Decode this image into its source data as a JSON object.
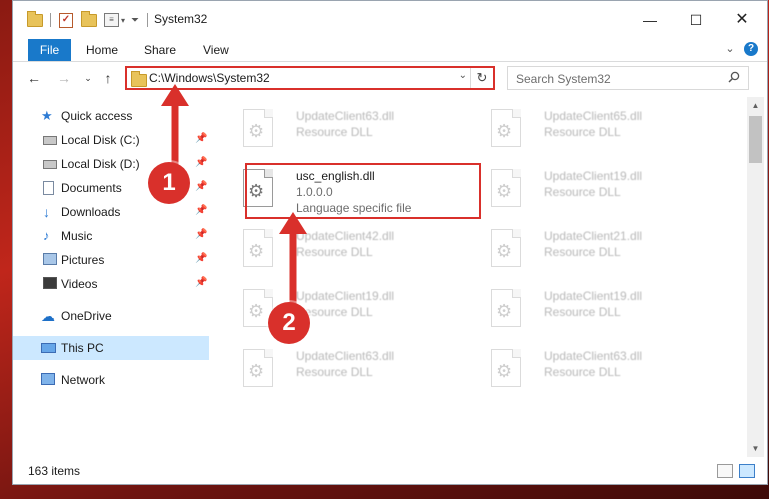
{
  "window": {
    "title": "System32"
  },
  "ribbon": {
    "tabs": [
      "File",
      "Home",
      "Share",
      "View"
    ]
  },
  "address": {
    "path": "C:\\Windows\\System32"
  },
  "search": {
    "placeholder": "Search System32"
  },
  "sidebar": {
    "items": [
      {
        "label": "Quick access",
        "icon": "star-icon",
        "pinned": false
      },
      {
        "label": "Local Disk (C:)",
        "icon": "drive-icon",
        "pinned": true
      },
      {
        "label": "Local Disk (D:)",
        "icon": "drive-icon",
        "pinned": true
      },
      {
        "label": "Documents",
        "icon": "documents-icon",
        "pinned": true
      },
      {
        "label": "Downloads",
        "icon": "downloads-icon",
        "pinned": true
      },
      {
        "label": "Music",
        "icon": "music-icon",
        "pinned": true
      },
      {
        "label": "Pictures",
        "icon": "pictures-icon",
        "pinned": true
      },
      {
        "label": "Videos",
        "icon": "videos-icon",
        "pinned": true
      },
      {
        "label": "OneDrive",
        "icon": "onedrive-icon",
        "pinned": false
      },
      {
        "label": "This PC",
        "icon": "this-pc-icon",
        "pinned": false,
        "selected": true
      },
      {
        "label": "Network",
        "icon": "network-icon",
        "pinned": false
      }
    ]
  },
  "files": [
    {
      "name": "UpdateClient63.dll",
      "type": "Resource DLL",
      "faded": true
    },
    {
      "name": "UpdateClient65.dll",
      "type": "Resource DLL",
      "faded": true
    },
    {
      "name": "usc_english.dll",
      "version": "1.0.0.0",
      "type": "Language specific file",
      "faded": false,
      "highlighted": true
    },
    {
      "name": "UpdateClient19.dll",
      "type": "Resource DLL",
      "faded": true
    },
    {
      "name": "UpdateClient42.dll",
      "type": "Resource DLL",
      "faded": true
    },
    {
      "name": "UpdateClient21.dll",
      "type": "Resource DLL",
      "faded": true
    },
    {
      "name": "UpdateClient19.dll",
      "type": "Resource DLL",
      "faded": true
    },
    {
      "name": "UpdateClient19.dll",
      "type": "Resource DLL",
      "faded": true
    },
    {
      "name": "UpdateClient63.dll",
      "type": "Resource DLL",
      "faded": true
    },
    {
      "name": "UpdateClient63.dll",
      "type": "Resource DLL",
      "faded": true
    }
  ],
  "status": {
    "count": "163 items"
  },
  "annotations": {
    "step1": "1",
    "step2": "2",
    "accent": "#d9302b"
  }
}
